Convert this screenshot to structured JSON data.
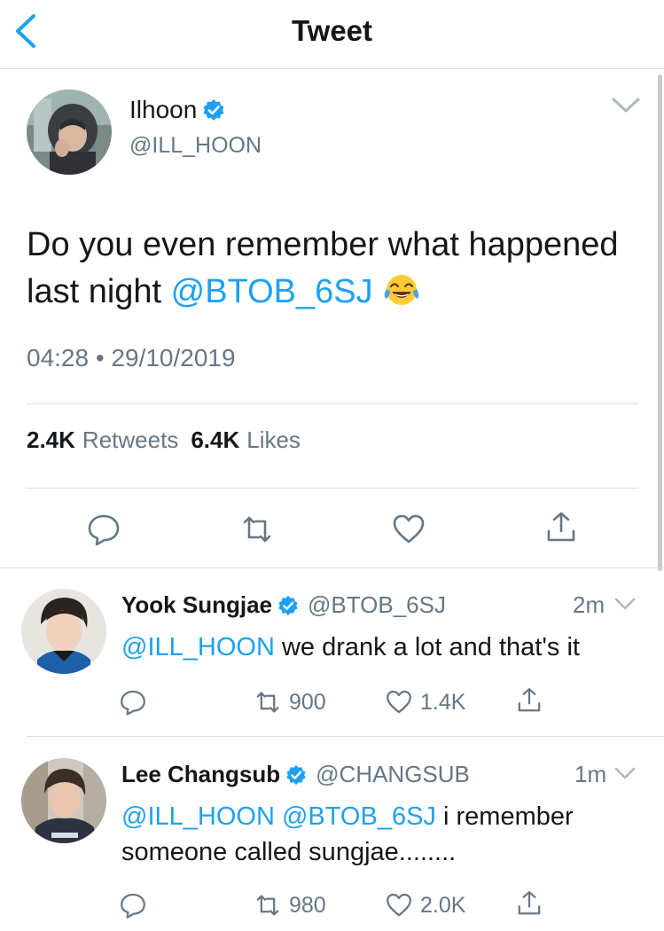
{
  "header": {
    "title": "Tweet",
    "back_icon": "chevron-left-icon"
  },
  "main_tweet": {
    "author_name": "Ilhoon",
    "author_handle": "@ILL_HOON",
    "verified": true,
    "text_before": "Do you even remember what happened last night ",
    "mention": "@BTOB_6SJ",
    "emoji": "face-with-tears-of-joy",
    "timestamp": "04:28 • 29/10/2019",
    "retweets_count": "2.4K",
    "retweets_label": "Retweets",
    "likes_count": "6.4K",
    "likes_label": "Likes",
    "actions": [
      "reply-icon",
      "retweet-icon",
      "like-icon",
      "share-icon"
    ]
  },
  "replies": [
    {
      "author_name": "Yook Sungjae",
      "author_handle": "@BTOB_6SJ",
      "time": "2m",
      "mention": "@ILL_HOON",
      "text": " we drank a lot and that's it",
      "retweets": "900",
      "likes": "1.4K"
    },
    {
      "author_name": "Lee Changsub",
      "author_handle": "@CHANGSUB",
      "time": "1m",
      "mention_1": "@ILL_HOON",
      "mention_2": "@BTOB_6SJ",
      "text": " i remember someone called sungjae........",
      "retweets": "980",
      "likes": "2.0K"
    }
  ],
  "colors": {
    "accent": "#1da1f2",
    "muted": "#657786",
    "text": "#14171a",
    "divider": "#d8dde1"
  }
}
